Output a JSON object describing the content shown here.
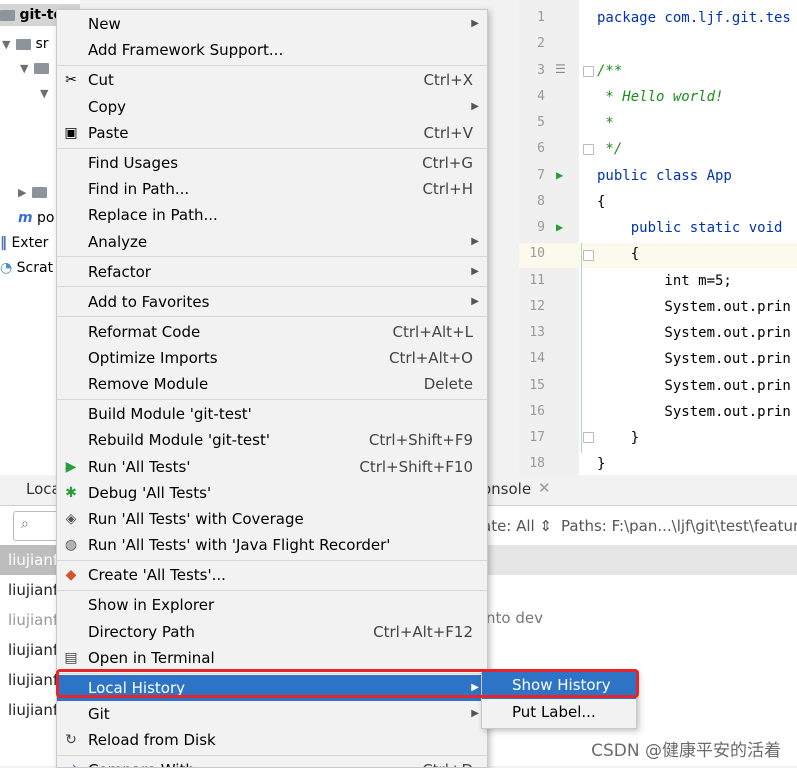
{
  "tree": {
    "root": "git-te",
    "items": [
      "sr",
      "po",
      "Exter",
      "Scrat"
    ]
  },
  "editor": {
    "lines": [
      {
        "n": "1",
        "text": "package com.ljf.git.tes"
      },
      {
        "n": "2",
        "text": ""
      },
      {
        "n": "3",
        "text": "/**"
      },
      {
        "n": "4",
        "text": " * Hello world!"
      },
      {
        "n": "5",
        "text": " *"
      },
      {
        "n": "6",
        "text": " */"
      },
      {
        "n": "7",
        "text": "public class App"
      },
      {
        "n": "8",
        "text": "{"
      },
      {
        "n": "9",
        "text": "    public static void"
      },
      {
        "n": "10",
        "text": "    {"
      },
      {
        "n": "11",
        "text": "        int m=5;"
      },
      {
        "n": "12",
        "text": "        System.out.prin"
      },
      {
        "n": "13",
        "text": "        System.out.prin"
      },
      {
        "n": "14",
        "text": "        System.out.prin"
      },
      {
        "n": "15",
        "text": "        System.out.prin"
      },
      {
        "n": "16",
        "text": "        System.out.prin"
      },
      {
        "n": "17",
        "text": "    }"
      },
      {
        "n": "18",
        "text": "}"
      }
    ]
  },
  "bottom": {
    "tab_local": "Loca",
    "tab_console": "onsole",
    "date_filter": "ate: All",
    "paths": "Paths: F:\\pan...\\ljf\\git\\test\\feature",
    "rows": [
      "liujianf",
      "liujianf",
      "liujianf",
      "liujianf",
      "liujianf",
      "liujianf"
    ],
    "into_dev": "nto dev"
  },
  "menu": {
    "items": [
      {
        "label": "New",
        "shortcut": "",
        "arrow": true,
        "icon": ""
      },
      {
        "label": "Add Framework Support...",
        "shortcut": "",
        "arrow": false,
        "icon": ""
      },
      {
        "label": "Cut",
        "shortcut": "Ctrl+X",
        "arrow": false,
        "icon": "scissors-icon"
      },
      {
        "label": "Copy",
        "shortcut": "",
        "arrow": true,
        "icon": ""
      },
      {
        "label": "Paste",
        "shortcut": "Ctrl+V",
        "arrow": false,
        "icon": "clipboard-icon"
      },
      {
        "label": "Find Usages",
        "shortcut": "Ctrl+G",
        "arrow": false,
        "icon": ""
      },
      {
        "label": "Find in Path...",
        "shortcut": "Ctrl+H",
        "arrow": false,
        "icon": ""
      },
      {
        "label": "Replace in Path...",
        "shortcut": "",
        "arrow": false,
        "icon": ""
      },
      {
        "label": "Analyze",
        "shortcut": "",
        "arrow": true,
        "icon": ""
      },
      {
        "label": "Refactor",
        "shortcut": "",
        "arrow": true,
        "icon": ""
      },
      {
        "label": "Add to Favorites",
        "shortcut": "",
        "arrow": true,
        "icon": ""
      },
      {
        "label": "Reformat Code",
        "shortcut": "Ctrl+Alt+L",
        "arrow": false,
        "icon": ""
      },
      {
        "label": "Optimize Imports",
        "shortcut": "Ctrl+Alt+O",
        "arrow": false,
        "icon": ""
      },
      {
        "label": "Remove Module",
        "shortcut": "Delete",
        "arrow": false,
        "icon": ""
      },
      {
        "label": "Build Module 'git-test'",
        "shortcut": "",
        "arrow": false,
        "icon": ""
      },
      {
        "label": "Rebuild Module 'git-test'",
        "shortcut": "Ctrl+Shift+F9",
        "arrow": false,
        "icon": ""
      },
      {
        "label": "Run 'All Tests'",
        "shortcut": "Ctrl+Shift+F10",
        "arrow": false,
        "icon": "run-icon"
      },
      {
        "label": "Debug 'All Tests'",
        "shortcut": "",
        "arrow": false,
        "icon": "debug-icon"
      },
      {
        "label": "Run 'All Tests' with Coverage",
        "shortcut": "",
        "arrow": false,
        "icon": "coverage-icon"
      },
      {
        "label": "Run 'All Tests' with 'Java Flight Recorder'",
        "shortcut": "",
        "arrow": false,
        "icon": "profiler-icon"
      },
      {
        "label": "Create 'All Tests'...",
        "shortcut": "",
        "arrow": false,
        "icon": "create-config-icon"
      },
      {
        "label": "Show in Explorer",
        "shortcut": "",
        "arrow": false,
        "icon": ""
      },
      {
        "label": "Directory Path",
        "shortcut": "Ctrl+Alt+F12",
        "arrow": false,
        "icon": ""
      },
      {
        "label": "Open in Terminal",
        "shortcut": "",
        "arrow": false,
        "icon": "terminal-icon"
      },
      {
        "label": "Local History",
        "shortcut": "",
        "arrow": true,
        "icon": ""
      },
      {
        "label": "Git",
        "shortcut": "",
        "arrow": true,
        "icon": ""
      },
      {
        "label": "Reload from Disk",
        "shortcut": "",
        "arrow": false,
        "icon": "reload-icon"
      },
      {
        "label": "Compare With...",
        "shortcut": "Ctrl+D",
        "arrow": false,
        "icon": "compare-icon"
      }
    ]
  },
  "submenu": {
    "items": [
      "Show History",
      "Put Label..."
    ]
  },
  "watermark": "CSDN @健康平安的活着",
  "colors": {
    "selection": "#2d74c7",
    "highlight_box": "#e8242a",
    "run_green": "#2a9d3a"
  }
}
